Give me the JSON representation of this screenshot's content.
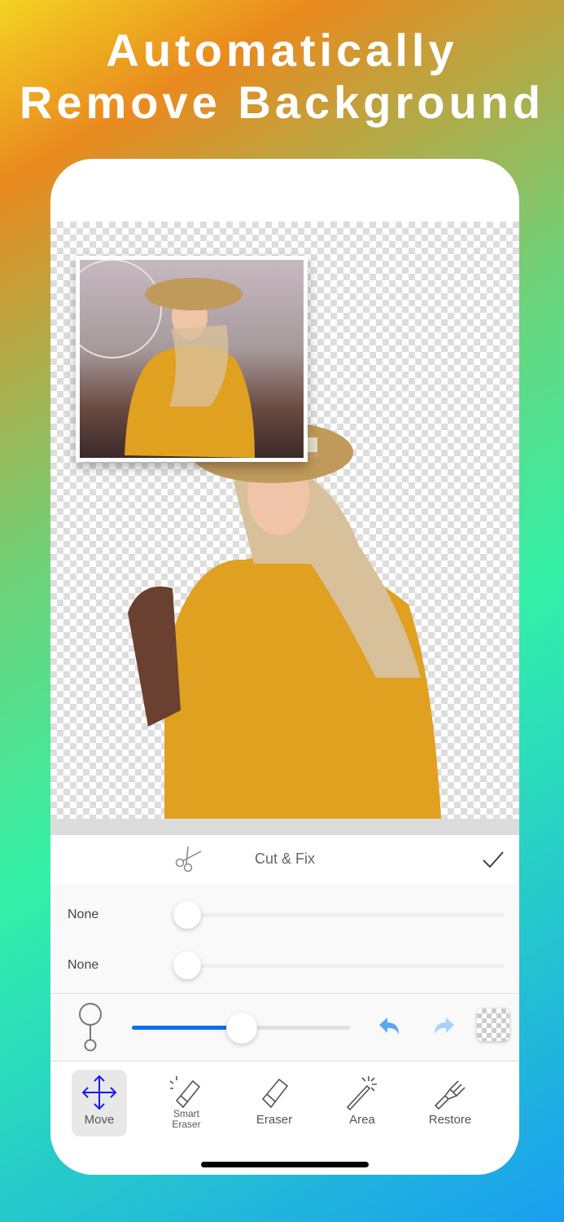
{
  "headline": {
    "line1": "Automatically",
    "line2": "Remove Background"
  },
  "panel": {
    "title": "Cut & Fix",
    "scissors_icon": "scissors-icon",
    "confirm_icon": "checkmark-icon"
  },
  "sliders": [
    {
      "label": "None",
      "value": 0
    },
    {
      "label": "None",
      "value": 0
    }
  ],
  "brush_size": {
    "value": 0.5,
    "accent": "#0a6cf5"
  },
  "toolbar": {
    "undo": "undo-icon",
    "redo": "redo-icon",
    "background": "checker-icon"
  },
  "tabs": [
    {
      "label": "Move",
      "active": true
    },
    {
      "label": "Smart Eraser"
    },
    {
      "label": "Eraser"
    },
    {
      "label": "Area"
    },
    {
      "label": "Restore"
    }
  ]
}
